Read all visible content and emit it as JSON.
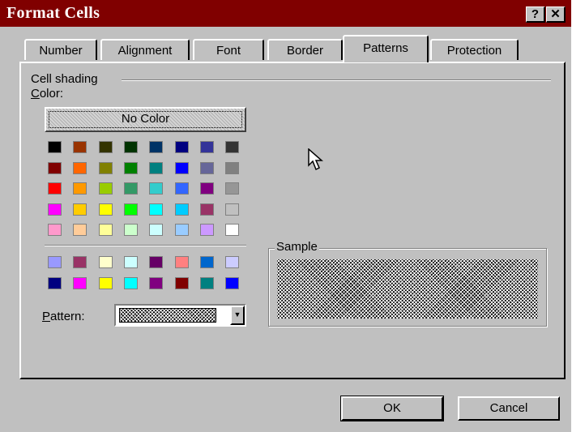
{
  "window": {
    "title": "Format Cells",
    "help_label": "?",
    "close_label": "✕"
  },
  "tabs": [
    {
      "label": "Number"
    },
    {
      "label": "Alignment"
    },
    {
      "label": "Font"
    },
    {
      "label": "Border"
    },
    {
      "label": "Patterns",
      "active": true
    },
    {
      "label": "Protection"
    }
  ],
  "cell_shading": {
    "group_label": "Cell shading",
    "color_label_underlined": "C",
    "color_label_rest": "olor:",
    "no_color_label": "No Color",
    "palette_main": [
      [
        "#000000",
        "#993300",
        "#333300",
        "#003300",
        "#003366",
        "#000080",
        "#333399",
        "#333333"
      ],
      [
        "#800000",
        "#ff6600",
        "#808000",
        "#008000",
        "#008080",
        "#0000ff",
        "#666699",
        "#808080"
      ],
      [
        "#ff0000",
        "#ff9900",
        "#99cc00",
        "#339966",
        "#33cccc",
        "#3366ff",
        "#800080",
        "#969696"
      ],
      [
        "#ff00ff",
        "#ffcc00",
        "#ffff00",
        "#00ff00",
        "#00ffff",
        "#00ccff",
        "#993366",
        "#c0c0c0"
      ],
      [
        "#ff99cc",
        "#ffcc99",
        "#ffff99",
        "#ccffcc",
        "#ccffff",
        "#99ccff",
        "#cc99ff",
        "#ffffff"
      ]
    ],
    "palette_chart": [
      [
        "#9999ff",
        "#993366",
        "#ffffcc",
        "#ccffff",
        "#660066",
        "#ff8080",
        "#0066cc",
        "#ccccff"
      ],
      [
        "#000080",
        "#ff00ff",
        "#ffff00",
        "#00ffff",
        "#800080",
        "#800000",
        "#008080",
        "#0000ff"
      ]
    ],
    "pattern_label_underlined": "P",
    "pattern_label_rest": "attern:",
    "pattern_value": "50% gray",
    "dropdown_glyph": "▼"
  },
  "sample": {
    "label": "Sample"
  },
  "buttons": {
    "ok": "OK",
    "cancel": "Cancel"
  },
  "icons": {
    "cursor": "arrow-cursor-icon"
  }
}
